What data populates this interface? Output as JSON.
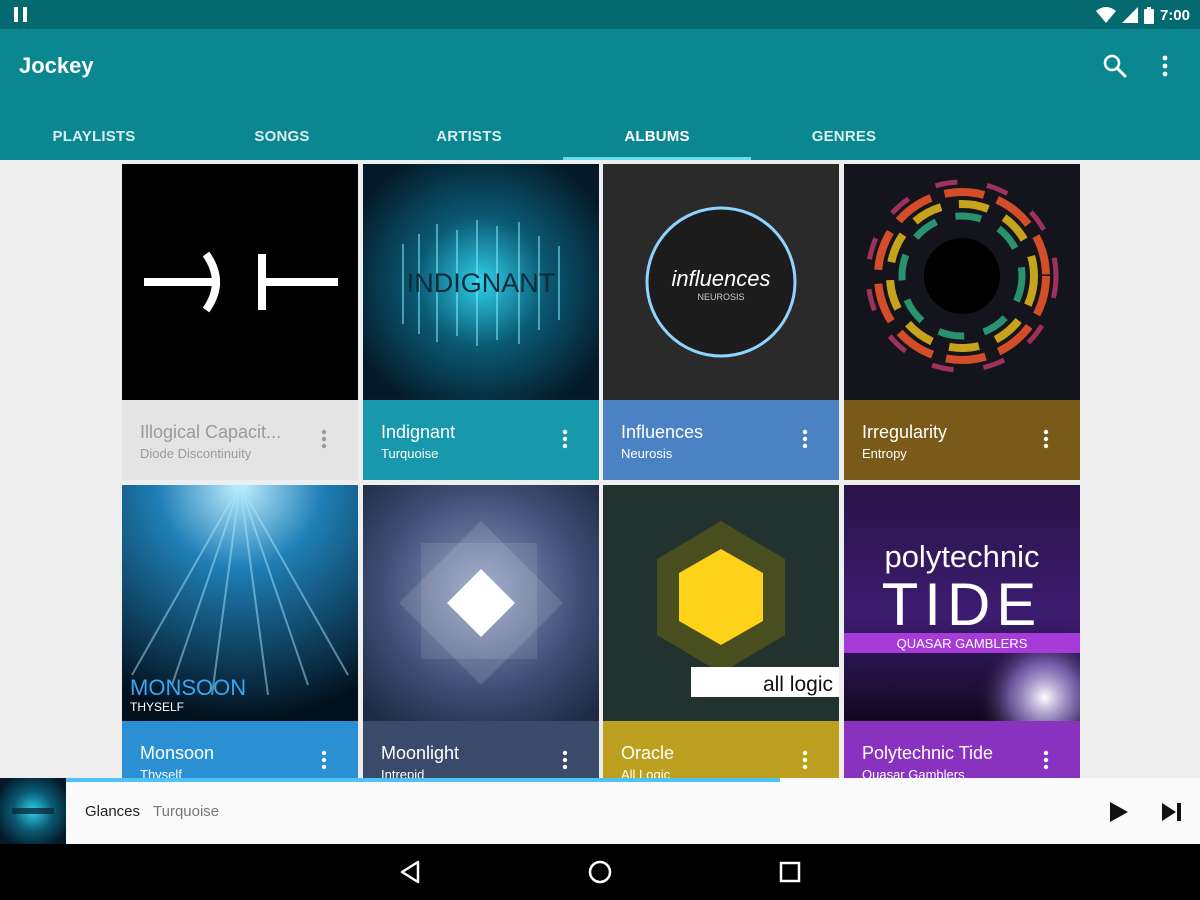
{
  "status_bar": {
    "time": "7:00"
  },
  "app_bar": {
    "title": "Jockey",
    "actions": [
      "search-icon",
      "more-vert-icon"
    ]
  },
  "tabs": [
    {
      "label": "PLAYLISTS",
      "active": false
    },
    {
      "label": "SONGS",
      "active": false
    },
    {
      "label": "ARTISTS",
      "active": false
    },
    {
      "label": "ALBUMS",
      "active": true
    },
    {
      "label": "GENRES",
      "active": false
    }
  ],
  "albums": [
    {
      "title": "Illogical Capacit...",
      "artist": "Diode Discontinuity",
      "color": "#e4e4e4",
      "text_color": "#9a9a9a"
    },
    {
      "title": "Indignant",
      "artist": "Turquoise",
      "color": "#1798ab",
      "text_color": "#ffffff",
      "art_text": "INDIGNANT"
    },
    {
      "title": "Influences",
      "artist": "Neurosis",
      "color": "#4b82c3",
      "text_color": "#ffffff",
      "art_text": "influences",
      "art_subtext": "NEUROSIS"
    },
    {
      "title": "Irregularity",
      "artist": "Entropy",
      "color": "#7a5a18",
      "text_color": "#ffffff"
    },
    {
      "title": "Monsoon",
      "artist": "Thyself",
      "color": "#2b8fd4",
      "text_color": "#ffffff",
      "art_text": "MONSOON",
      "art_subtext": "THYSELF"
    },
    {
      "title": "Moonlight",
      "artist": "Intrepid",
      "color": "#3a4a6a",
      "text_color": "#ffffff"
    },
    {
      "title": "Oracle",
      "artist": "All Logic",
      "color": "#bea020",
      "text_color": "#ffffff",
      "art_text": "all logic"
    },
    {
      "title": "Polytechnic Tide",
      "artist": "Quasar Gamblers",
      "color": "#8a32c0",
      "text_color": "#ffffff",
      "art_text": "polytechnic",
      "art_text2": "TIDE",
      "art_subtext": "QUASAR GAMBLERS"
    }
  ],
  "now_playing": {
    "title": "Glances",
    "artist": "Turquoise",
    "progress": 0.63,
    "controls": [
      "play-icon",
      "skip-next-icon"
    ]
  },
  "nav_bar": {
    "buttons": [
      "back-icon",
      "home-icon",
      "recents-icon"
    ]
  }
}
